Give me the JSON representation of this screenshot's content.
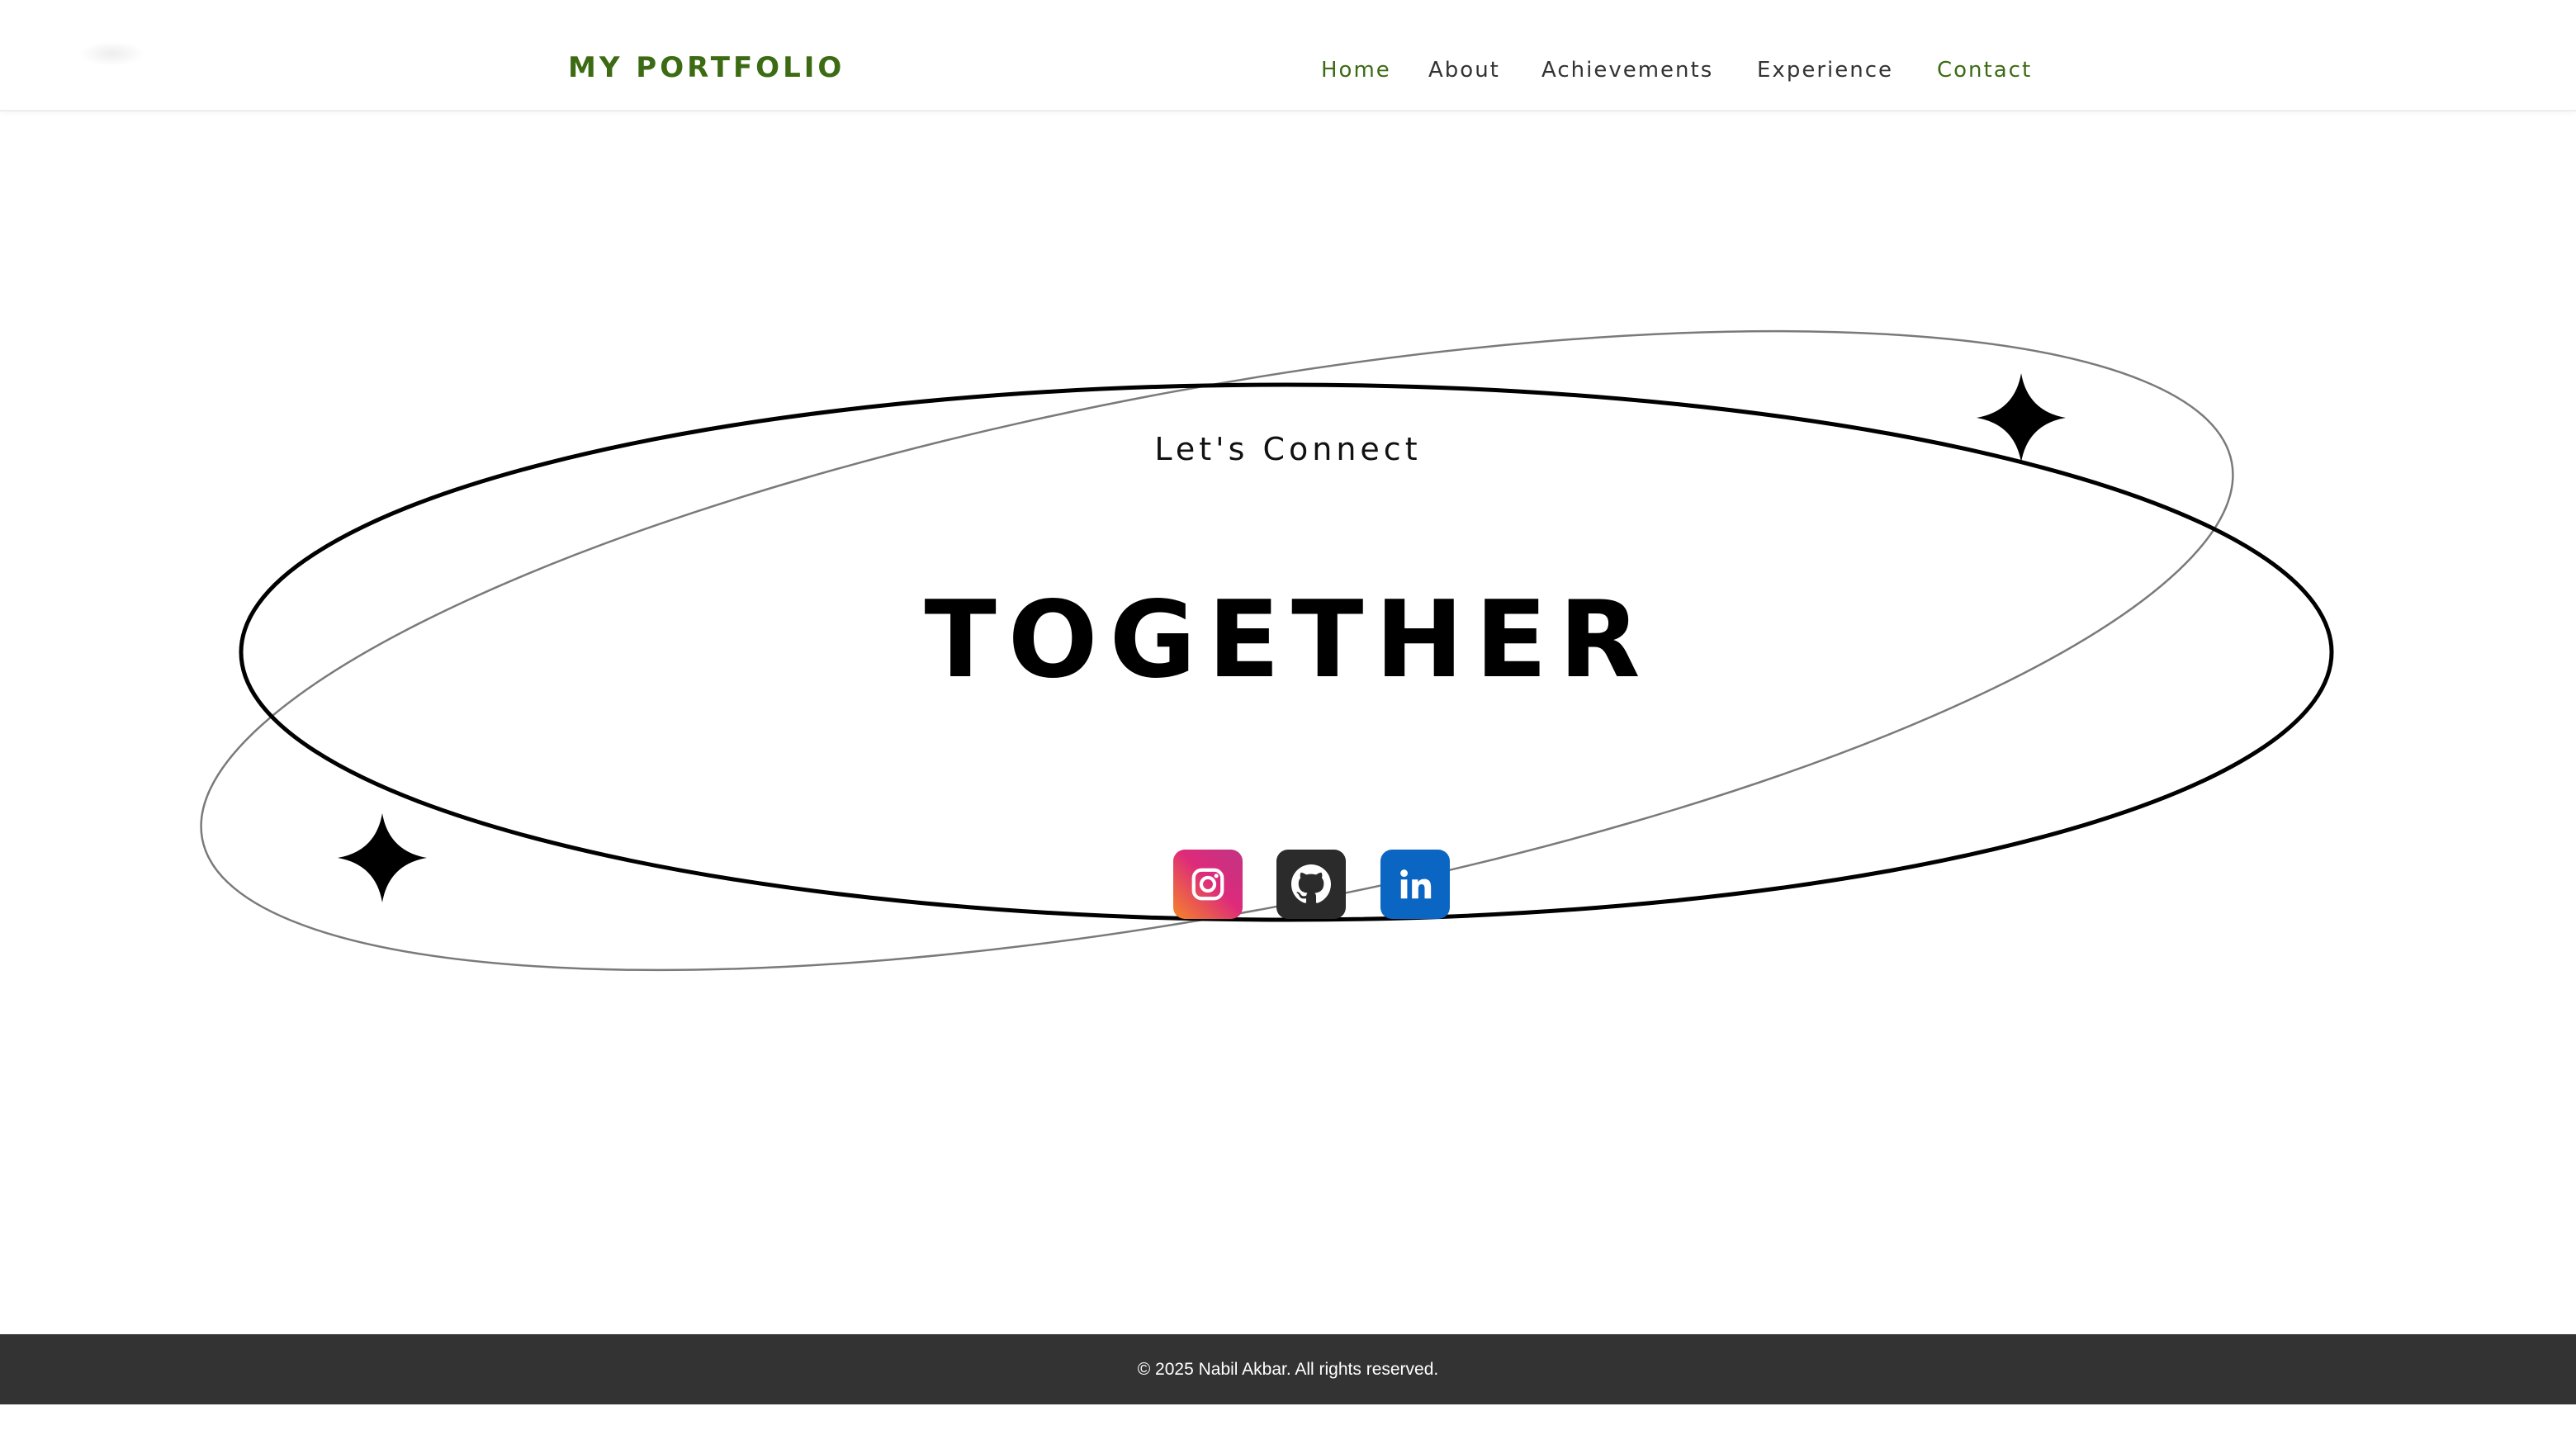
{
  "header": {
    "brand": "MY PORTFOLIO",
    "nav": [
      {
        "label": "Home",
        "active": true
      },
      {
        "label": "About",
        "active": false
      },
      {
        "label": "Achievements",
        "active": false
      },
      {
        "label": "Experience",
        "active": false
      },
      {
        "label": "Contact",
        "active": true
      }
    ]
  },
  "hero": {
    "subtitle": "Let's Connect",
    "headline": "TOGETHER",
    "decorations": [
      "sparkle-icon",
      "sparkle-icon"
    ]
  },
  "social": [
    {
      "name": "instagram",
      "icon": "instagram-icon",
      "color": "#dd2a7b"
    },
    {
      "name": "github",
      "icon": "github-icon",
      "color": "#2b2b2b"
    },
    {
      "name": "linkedin",
      "icon": "linkedin-icon",
      "color": "#0a66c2"
    }
  ],
  "footer": {
    "text": "© 2025 Nabil Akbar. All rights reserved."
  },
  "colors": {
    "accent": "#3d6b14",
    "text": "#333333",
    "footer_bg": "#333333"
  }
}
